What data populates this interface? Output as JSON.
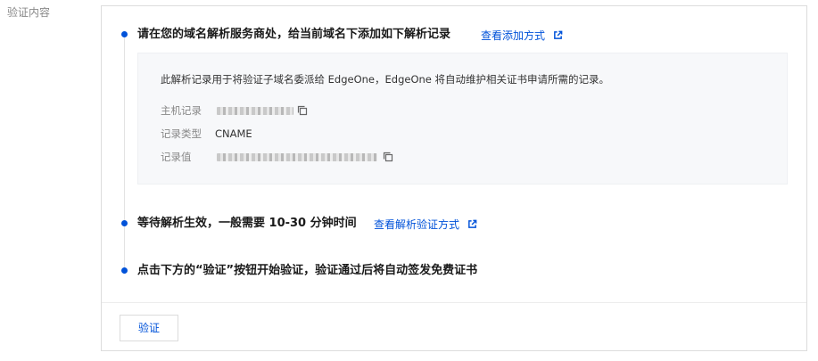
{
  "field_label": "验证内容",
  "steps": [
    {
      "title": "请在您的域名解析服务商处，给当前域名下添加如下解析记录",
      "link": "查看添加方式"
    },
    {
      "title": "等待解析生效，一般需要 10-30 分钟时间",
      "link": "查看解析验证方式"
    },
    {
      "title": "点击下方的“验证”按钮开始验证，验证通过后将自动签发免费证书"
    }
  ],
  "record_box": {
    "description": "此解析记录用于将验证子域名委派给 EdgeOne，EdgeOne 将自动维护相关证书申请所需的记录。",
    "rows": [
      {
        "label": "主机记录",
        "value": ""
      },
      {
        "label": "记录类型",
        "value": "CNAME"
      },
      {
        "label": "记录值",
        "value": ""
      }
    ]
  },
  "verify_button": "验证",
  "colors": {
    "accent": "#0052d9",
    "dot": "#0052d9",
    "box_bg": "#f7f8fa"
  },
  "icons": {
    "external_link": "external-link-icon",
    "copy": "copy-icon"
  }
}
